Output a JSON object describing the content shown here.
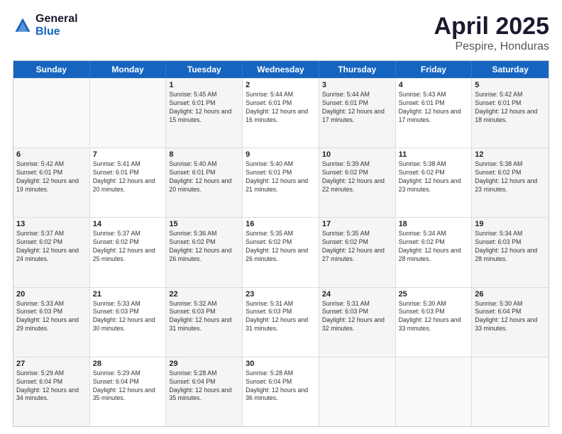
{
  "logo": {
    "general": "General",
    "blue": "Blue"
  },
  "title": "April 2025",
  "subtitle": "Pespire, Honduras",
  "weekdays": [
    "Sunday",
    "Monday",
    "Tuesday",
    "Wednesday",
    "Thursday",
    "Friday",
    "Saturday"
  ],
  "weeks": [
    [
      {
        "day": "",
        "info": ""
      },
      {
        "day": "",
        "info": ""
      },
      {
        "day": "1",
        "info": "Sunrise: 5:45 AM\nSunset: 6:01 PM\nDaylight: 12 hours and 15 minutes."
      },
      {
        "day": "2",
        "info": "Sunrise: 5:44 AM\nSunset: 6:01 PM\nDaylight: 12 hours and 16 minutes."
      },
      {
        "day": "3",
        "info": "Sunrise: 5:44 AM\nSunset: 6:01 PM\nDaylight: 12 hours and 17 minutes."
      },
      {
        "day": "4",
        "info": "Sunrise: 5:43 AM\nSunset: 6:01 PM\nDaylight: 12 hours and 17 minutes."
      },
      {
        "day": "5",
        "info": "Sunrise: 5:42 AM\nSunset: 6:01 PM\nDaylight: 12 hours and 18 minutes."
      }
    ],
    [
      {
        "day": "6",
        "info": "Sunrise: 5:42 AM\nSunset: 6:01 PM\nDaylight: 12 hours and 19 minutes."
      },
      {
        "day": "7",
        "info": "Sunrise: 5:41 AM\nSunset: 6:01 PM\nDaylight: 12 hours and 20 minutes."
      },
      {
        "day": "8",
        "info": "Sunrise: 5:40 AM\nSunset: 6:01 PM\nDaylight: 12 hours and 20 minutes."
      },
      {
        "day": "9",
        "info": "Sunrise: 5:40 AM\nSunset: 6:01 PM\nDaylight: 12 hours and 21 minutes."
      },
      {
        "day": "10",
        "info": "Sunrise: 5:39 AM\nSunset: 6:02 PM\nDaylight: 12 hours and 22 minutes."
      },
      {
        "day": "11",
        "info": "Sunrise: 5:38 AM\nSunset: 6:02 PM\nDaylight: 12 hours and 23 minutes."
      },
      {
        "day": "12",
        "info": "Sunrise: 5:38 AM\nSunset: 6:02 PM\nDaylight: 12 hours and 23 minutes."
      }
    ],
    [
      {
        "day": "13",
        "info": "Sunrise: 5:37 AM\nSunset: 6:02 PM\nDaylight: 12 hours and 24 minutes."
      },
      {
        "day": "14",
        "info": "Sunrise: 5:37 AM\nSunset: 6:02 PM\nDaylight: 12 hours and 25 minutes."
      },
      {
        "day": "15",
        "info": "Sunrise: 5:36 AM\nSunset: 6:02 PM\nDaylight: 12 hours and 26 minutes."
      },
      {
        "day": "16",
        "info": "Sunrise: 5:35 AM\nSunset: 6:02 PM\nDaylight: 12 hours and 26 minutes."
      },
      {
        "day": "17",
        "info": "Sunrise: 5:35 AM\nSunset: 6:02 PM\nDaylight: 12 hours and 27 minutes."
      },
      {
        "day": "18",
        "info": "Sunrise: 5:34 AM\nSunset: 6:02 PM\nDaylight: 12 hours and 28 minutes."
      },
      {
        "day": "19",
        "info": "Sunrise: 5:34 AM\nSunset: 6:03 PM\nDaylight: 12 hours and 28 minutes."
      }
    ],
    [
      {
        "day": "20",
        "info": "Sunrise: 5:33 AM\nSunset: 6:03 PM\nDaylight: 12 hours and 29 minutes."
      },
      {
        "day": "21",
        "info": "Sunrise: 5:33 AM\nSunset: 6:03 PM\nDaylight: 12 hours and 30 minutes."
      },
      {
        "day": "22",
        "info": "Sunrise: 5:32 AM\nSunset: 6:03 PM\nDaylight: 12 hours and 31 minutes."
      },
      {
        "day": "23",
        "info": "Sunrise: 5:31 AM\nSunset: 6:03 PM\nDaylight: 12 hours and 31 minutes."
      },
      {
        "day": "24",
        "info": "Sunrise: 5:31 AM\nSunset: 6:03 PM\nDaylight: 12 hours and 32 minutes."
      },
      {
        "day": "25",
        "info": "Sunrise: 5:30 AM\nSunset: 6:03 PM\nDaylight: 12 hours and 33 minutes."
      },
      {
        "day": "26",
        "info": "Sunrise: 5:30 AM\nSunset: 6:04 PM\nDaylight: 12 hours and 33 minutes."
      }
    ],
    [
      {
        "day": "27",
        "info": "Sunrise: 5:29 AM\nSunset: 6:04 PM\nDaylight: 12 hours and 34 minutes."
      },
      {
        "day": "28",
        "info": "Sunrise: 5:29 AM\nSunset: 6:04 PM\nDaylight: 12 hours and 35 minutes."
      },
      {
        "day": "29",
        "info": "Sunrise: 5:28 AM\nSunset: 6:04 PM\nDaylight: 12 hours and 35 minutes."
      },
      {
        "day": "30",
        "info": "Sunrise: 5:28 AM\nSunset: 6:04 PM\nDaylight: 12 hours and 36 minutes."
      },
      {
        "day": "",
        "info": ""
      },
      {
        "day": "",
        "info": ""
      },
      {
        "day": "",
        "info": ""
      }
    ]
  ]
}
